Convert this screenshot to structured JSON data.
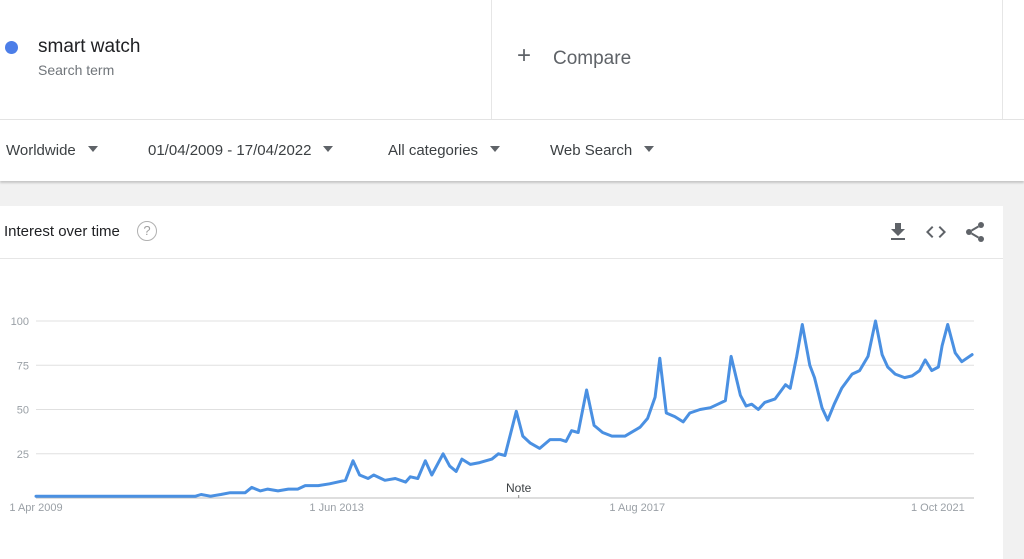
{
  "search_term": {
    "name": "smart watch",
    "subtitle": "Search term",
    "color": "#4c7ee8"
  },
  "compare": {
    "icon": "plus-icon",
    "label": "Compare"
  },
  "filters": {
    "region": "Worldwide",
    "date_range": "01/04/2009 - 17/04/2022",
    "category": "All categories",
    "search_type": "Web Search"
  },
  "card": {
    "title": "Interest over time",
    "help_icon": "?",
    "actions": [
      "download-icon",
      "embed-code-icon",
      "share-icon"
    ]
  },
  "chart_data": {
    "type": "line",
    "title": "Interest over time",
    "xlabel": "",
    "ylabel": "",
    "ylim": [
      0,
      100
    ],
    "yticks": [
      25,
      50,
      75,
      100
    ],
    "ytick_labels": [
      "25",
      "50",
      "75",
      "100"
    ],
    "xlim": [
      "2009-04",
      "2022-04"
    ],
    "xticks": [
      {
        "label": "1 Apr 2009",
        "t": 0
      },
      {
        "label": "1 Jun 2013",
        "t": 0.3205
      },
      {
        "label": "1 Aug 2017",
        "t": 0.641
      },
      {
        "label": "1 Oct 2021",
        "t": 0.9615
      }
    ],
    "annotation": {
      "label": "Note",
      "t": 0.5146
    },
    "grid": true,
    "legend": "none",
    "series": [
      {
        "name": "smart watch",
        "color": "#4a90e2",
        "points": [
          [
            0.0,
            1
          ],
          [
            0.17,
            1
          ],
          [
            0.176,
            2
          ],
          [
            0.186,
            1
          ],
          [
            0.197,
            2
          ],
          [
            0.207,
            3
          ],
          [
            0.223,
            3
          ],
          [
            0.23,
            6
          ],
          [
            0.239,
            4
          ],
          [
            0.247,
            5
          ],
          [
            0.258,
            4
          ],
          [
            0.269,
            5
          ],
          [
            0.279,
            5
          ],
          [
            0.287,
            7
          ],
          [
            0.301,
            7
          ],
          [
            0.313,
            8
          ],
          [
            0.33,
            10
          ],
          [
            0.338,
            21
          ],
          [
            0.345,
            13
          ],
          [
            0.354,
            11
          ],
          [
            0.36,
            13
          ],
          [
            0.372,
            10
          ],
          [
            0.383,
            11
          ],
          [
            0.394,
            9
          ],
          [
            0.399,
            12
          ],
          [
            0.407,
            11
          ],
          [
            0.415,
            21
          ],
          [
            0.422,
            13
          ],
          [
            0.434,
            25
          ],
          [
            0.441,
            18
          ],
          [
            0.448,
            15
          ],
          [
            0.454,
            22
          ],
          [
            0.463,
            19
          ],
          [
            0.473,
            20
          ],
          [
            0.486,
            22
          ],
          [
            0.493,
            25
          ],
          [
            0.5,
            24
          ],
          [
            0.512,
            49
          ],
          [
            0.519,
            35
          ],
          [
            0.527,
            31
          ],
          [
            0.537,
            28
          ],
          [
            0.548,
            33
          ],
          [
            0.559,
            33
          ],
          [
            0.565,
            32
          ],
          [
            0.571,
            38
          ],
          [
            0.578,
            37
          ],
          [
            0.587,
            61
          ],
          [
            0.595,
            41
          ],
          [
            0.604,
            37
          ],
          [
            0.614,
            35
          ],
          [
            0.628,
            35
          ],
          [
            0.644,
            40
          ],
          [
            0.652,
            45
          ],
          [
            0.66,
            57
          ],
          [
            0.665,
            79
          ],
          [
            0.672,
            48
          ],
          [
            0.681,
            46
          ],
          [
            0.69,
            43
          ],
          [
            0.697,
            48
          ],
          [
            0.708,
            50
          ],
          [
            0.719,
            51
          ],
          [
            0.727,
            53
          ],
          [
            0.735,
            55
          ],
          [
            0.741,
            80
          ],
          [
            0.751,
            58
          ],
          [
            0.757,
            52
          ],
          [
            0.763,
            53
          ],
          [
            0.77,
            50
          ],
          [
            0.777,
            54
          ],
          [
            0.788,
            56
          ],
          [
            0.799,
            64
          ],
          [
            0.804,
            62
          ],
          [
            0.811,
            80
          ],
          [
            0.817,
            98
          ],
          [
            0.825,
            75
          ],
          [
            0.83,
            68
          ],
          [
            0.838,
            51
          ],
          [
            0.844,
            44
          ],
          [
            0.851,
            53
          ],
          [
            0.859,
            62
          ],
          [
            0.87,
            70
          ],
          [
            0.878,
            72
          ],
          [
            0.887,
            80
          ],
          [
            0.895,
            100
          ],
          [
            0.902,
            81
          ],
          [
            0.908,
            74
          ],
          [
            0.916,
            70
          ],
          [
            0.926,
            68
          ],
          [
            0.934,
            69
          ],
          [
            0.942,
            72
          ],
          [
            0.948,
            78
          ],
          [
            0.955,
            72
          ],
          [
            0.962,
            74
          ],
          [
            0.966,
            86
          ],
          [
            0.972,
            98
          ],
          [
            0.98,
            82
          ],
          [
            0.987,
            77
          ],
          [
            0.998,
            81
          ]
        ]
      }
    ]
  }
}
